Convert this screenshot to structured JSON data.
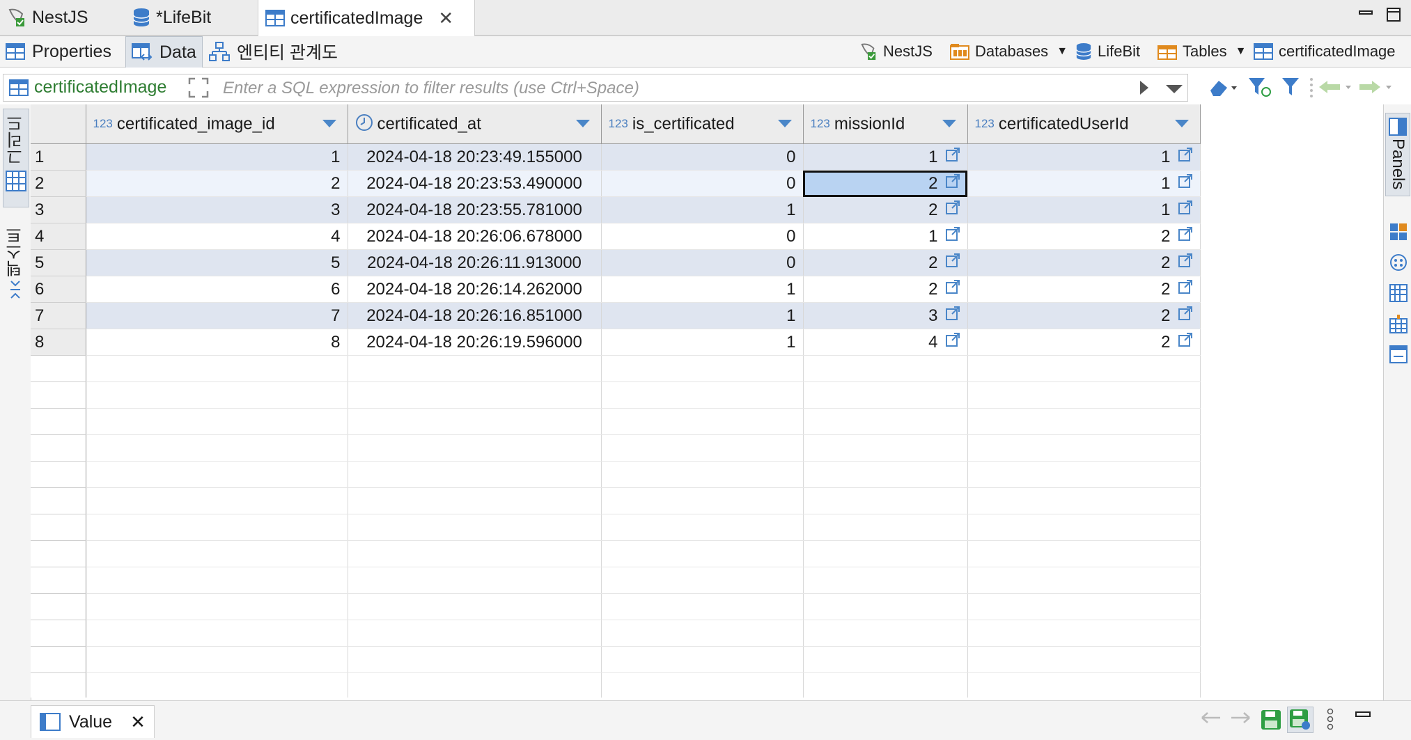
{
  "editor_tabs": [
    {
      "label": "NestJS",
      "icon": "nestjs-connection-icon"
    },
    {
      "label": "*LifeBit",
      "icon": "database-icon"
    },
    {
      "label": "certificatedImage",
      "icon": "table-icon",
      "active": true
    }
  ],
  "sub_tabs": [
    {
      "label": "Properties",
      "icon": "properties-icon"
    },
    {
      "label": "Data",
      "icon": "data-icon",
      "active": true
    },
    {
      "label": "엔티티 관계도",
      "icon": "er-diagram-icon"
    }
  ],
  "breadcrumb": [
    {
      "label": "NestJS",
      "icon": "nestjs-connection-icon",
      "dropdown": false
    },
    {
      "label": "Databases",
      "icon": "databases-folder-icon",
      "dropdown": true
    },
    {
      "label": "LifeBit",
      "icon": "database-icon",
      "dropdown": false
    },
    {
      "label": "Tables",
      "icon": "tables-folder-icon",
      "dropdown": true
    },
    {
      "label": "certificatedImage",
      "icon": "table-icon",
      "dropdown": false
    }
  ],
  "filter": {
    "table_name": "certificatedImage",
    "placeholder": "Enter a SQL expression to filter results (use Ctrl+Space)"
  },
  "left_tabs": {
    "grid": "그리드",
    "text": "텍스트"
  },
  "right_tabs": {
    "panels": "Panels"
  },
  "grid": {
    "columns": [
      {
        "name": "certificated_image_id",
        "type_label": "123",
        "type": "numeric-key"
      },
      {
        "name": "certificated_at",
        "type_label": "clock",
        "type": "datetime"
      },
      {
        "name": "is_certificated",
        "type_label": "123",
        "type": "numeric"
      },
      {
        "name": "missionId",
        "type_label": "123",
        "type": "numeric-fk"
      },
      {
        "name": "certificatedUserId",
        "type_label": "123",
        "type": "numeric-fk"
      }
    ],
    "rows": [
      {
        "n": "1",
        "id": "1",
        "at": "2024-04-18 20:23:49.155000",
        "cert": "0",
        "mission": "1",
        "user": "1"
      },
      {
        "n": "2",
        "id": "2",
        "at": "2024-04-18 20:23:53.490000",
        "cert": "0",
        "mission": "2",
        "user": "1"
      },
      {
        "n": "3",
        "id": "3",
        "at": "2024-04-18 20:23:55.781000",
        "cert": "1",
        "mission": "2",
        "user": "1"
      },
      {
        "n": "4",
        "id": "4",
        "at": "2024-04-18 20:26:06.678000",
        "cert": "0",
        "mission": "1",
        "user": "2"
      },
      {
        "n": "5",
        "id": "5",
        "at": "2024-04-18 20:26:11.913000",
        "cert": "0",
        "mission": "2",
        "user": "2"
      },
      {
        "n": "6",
        "id": "6",
        "at": "2024-04-18 20:26:14.262000",
        "cert": "1",
        "mission": "2",
        "user": "2"
      },
      {
        "n": "7",
        "id": "7",
        "at": "2024-04-18 20:26:16.851000",
        "cert": "1",
        "mission": "3",
        "user": "2"
      },
      {
        "n": "8",
        "id": "8",
        "at": "2024-04-18 20:26:19.596000",
        "cert": "1",
        "mission": "4",
        "user": "2"
      }
    ],
    "selected_row": 2,
    "focused_cell": "missionId"
  },
  "bottom": {
    "value_tab": "Value"
  },
  "colors": {
    "accent": "#4a86c8",
    "row_alt": "#dfe5f0",
    "focus_fill": "#b9d3f2",
    "table_name_green": "#2e7d32",
    "save_green": "#2f9e44"
  }
}
